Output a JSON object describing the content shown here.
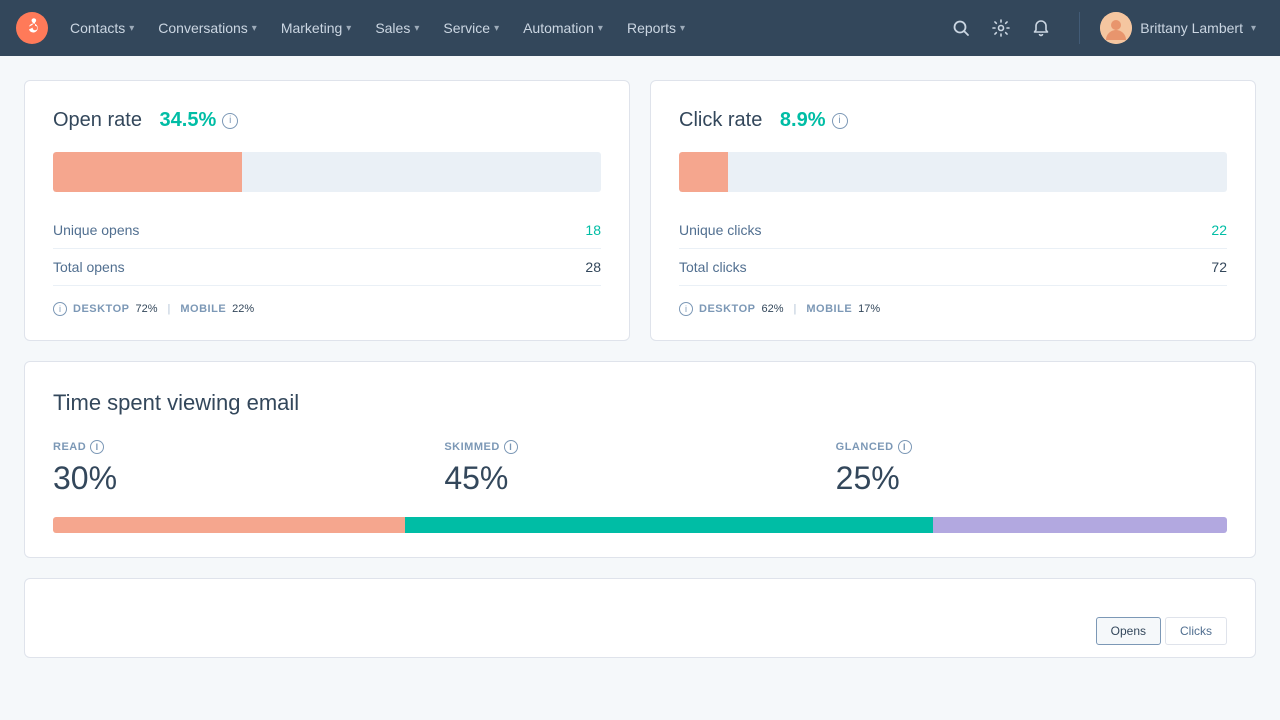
{
  "nav": {
    "logo_label": "HubSpot",
    "items": [
      {
        "label": "Contacts",
        "id": "contacts"
      },
      {
        "label": "Conversations",
        "id": "conversations"
      },
      {
        "label": "Marketing",
        "id": "marketing"
      },
      {
        "label": "Sales",
        "id": "sales"
      },
      {
        "label": "Service",
        "id": "service"
      },
      {
        "label": "Automation",
        "id": "automation"
      },
      {
        "label": "Reports",
        "id": "reports"
      }
    ],
    "user_name": "Brittany Lambert"
  },
  "open_rate_card": {
    "title_prefix": "Open rate",
    "rate_value": "34.5%",
    "bar_fill_percent": 34.5,
    "unique_opens_label": "Unique opens",
    "unique_opens_value": "18",
    "total_opens_label": "Total opens",
    "total_opens_value": "28",
    "footer_info": "i",
    "desktop_label": "DESKTOP",
    "desktop_value": "72%",
    "mobile_label": "MOBILE",
    "mobile_value": "22%"
  },
  "click_rate_card": {
    "title_prefix": "Click rate",
    "rate_value": "8.9%",
    "bar_fill_percent": 8.9,
    "unique_clicks_label": "Unique clicks",
    "unique_clicks_value": "22",
    "total_clicks_label": "Total clicks",
    "total_clicks_value": "72",
    "footer_info": "i",
    "desktop_label": "DESKTOP",
    "desktop_value": "62%",
    "mobile_label": "MOBILE",
    "mobile_value": "17%"
  },
  "time_card": {
    "title": "Time spent viewing email",
    "read_label": "READ",
    "read_value": "30%",
    "read_percent": 30,
    "skimmed_label": "SKIMMED",
    "skimmed_value": "45%",
    "skimmed_percent": 45,
    "glanced_label": "GLANCED",
    "glanced_value": "25%",
    "glanced_percent": 25
  },
  "bottom_card": {
    "opens_label": "Opens",
    "clicks_label": "Clicks"
  }
}
